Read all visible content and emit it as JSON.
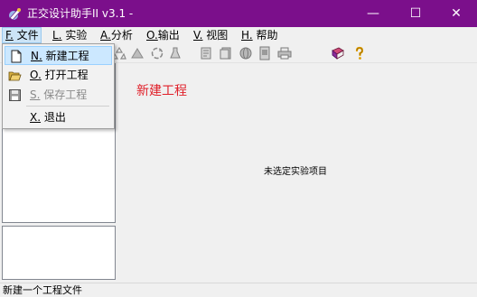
{
  "window": {
    "title": "正交设计助手II v3.1 -",
    "min_glyph": "—",
    "max_glyph": "☐",
    "close_glyph": "✕",
    "title_bar_color": "#7b0f8b"
  },
  "menubar": {
    "items": [
      {
        "mnemonic": "F.",
        "label": " 文件"
      },
      {
        "mnemonic": "L.",
        "label": " 实验"
      },
      {
        "mnemonic": "A.",
        "label": "分析"
      },
      {
        "mnemonic": "O.",
        "label": "输出"
      },
      {
        "mnemonic": "V.",
        "label": " 视图"
      },
      {
        "mnemonic": "H.",
        "label": " 帮助"
      }
    ]
  },
  "file_menu": {
    "items": [
      {
        "mnemonic": "N.",
        "label": " 新建工程",
        "icon": "new-document-icon",
        "enabled": true
      },
      {
        "mnemonic": "O.",
        "label": " 打开工程",
        "icon": "open-folder-icon",
        "enabled": true
      },
      {
        "mnemonic": "S.",
        "label": " 保存工程",
        "icon": "save-disk-icon",
        "enabled": false
      },
      {
        "mnemonic": "X.",
        "label": " 退出",
        "icon": "",
        "enabled": true
      }
    ]
  },
  "toolbar": {
    "icons": [
      "recycle-icon",
      "triangle-icon",
      "recycle-icon-2",
      "flask-icon",
      "report-icon",
      "notes-icon",
      "globe-icon",
      "document-icon",
      "printer-icon",
      "book-icon",
      "help-icon"
    ]
  },
  "content": {
    "project_title": "新建工程",
    "empty_message": "未选定实验项目",
    "title_color": "#e0202a"
  },
  "statusbar": {
    "text": "新建一个工程文件"
  }
}
